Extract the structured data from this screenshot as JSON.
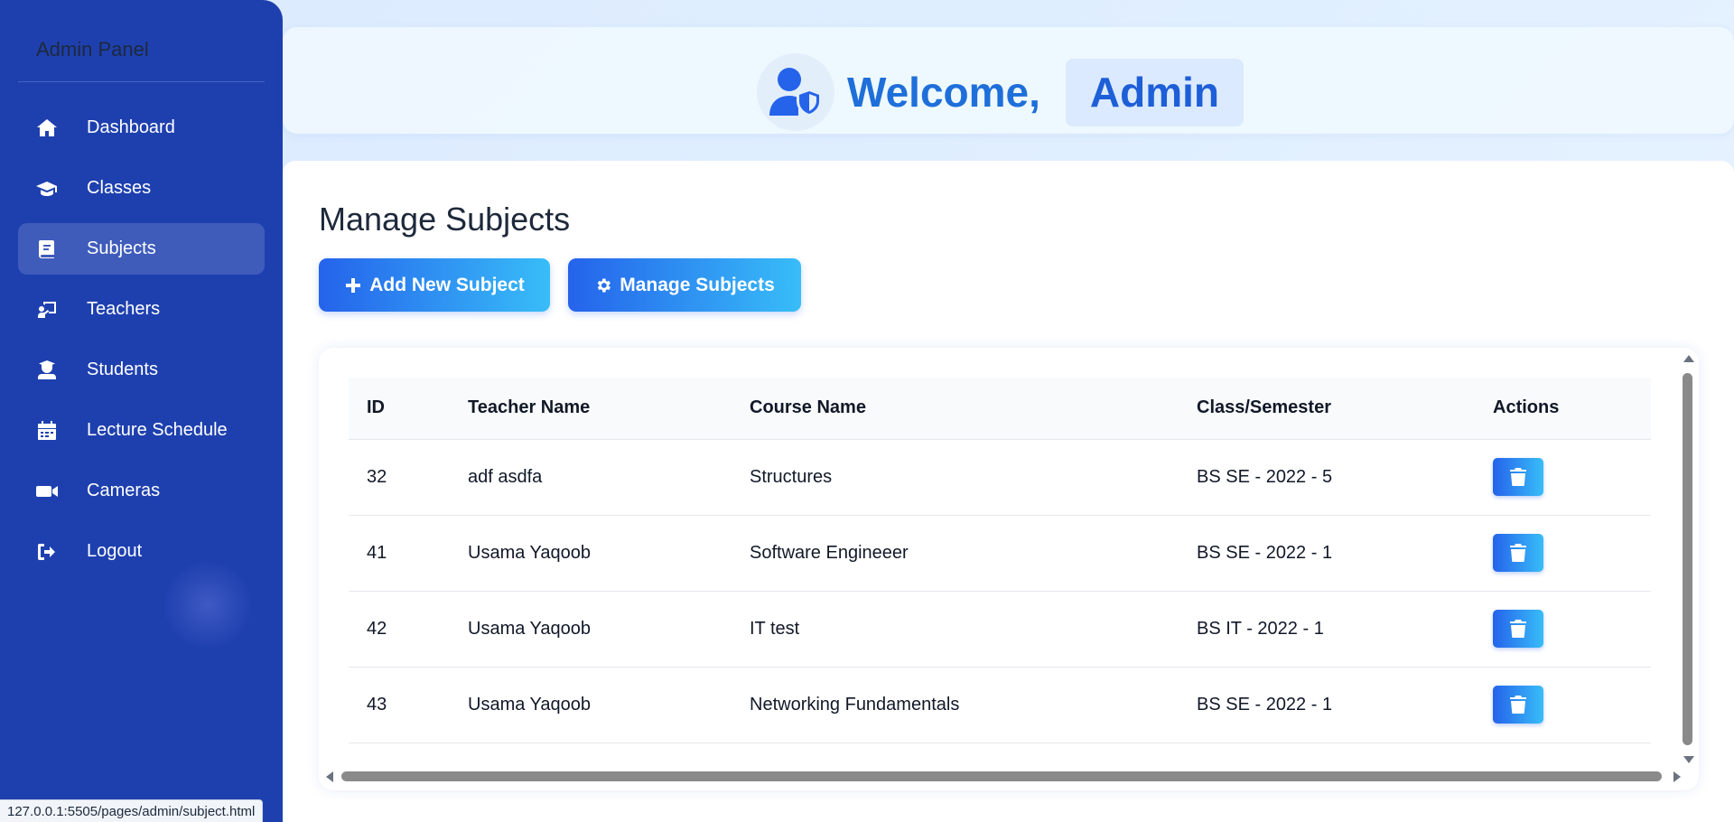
{
  "sidebar": {
    "brand": "Admin Panel",
    "items": [
      {
        "label": "Dashboard",
        "icon": "home-icon",
        "active": false
      },
      {
        "label": "Classes",
        "icon": "graduation-cap-icon",
        "active": false
      },
      {
        "label": "Subjects",
        "icon": "book-icon",
        "active": true
      },
      {
        "label": "Teachers",
        "icon": "chalkboard-teacher-icon",
        "active": false
      },
      {
        "label": "Students",
        "icon": "user-graduate-icon",
        "active": false
      },
      {
        "label": "Lecture Schedule",
        "icon": "calendar-icon",
        "active": false
      },
      {
        "label": "Cameras",
        "icon": "video-camera-icon",
        "active": false
      },
      {
        "label": "Logout",
        "icon": "sign-out-icon",
        "active": false
      }
    ]
  },
  "header": {
    "greeting": "Welcome,",
    "user_name": "Admin",
    "avatar_icon": "user-shield-icon"
  },
  "main": {
    "title": "Manage Subjects",
    "add_button": "Add New Subject",
    "manage_button": "Manage Subjects"
  },
  "table": {
    "columns": [
      "ID",
      "Teacher Name",
      "Course Name",
      "Class/Semester",
      "Actions"
    ],
    "rows": [
      {
        "id": "32",
        "teacher": "adf asdfa",
        "course": "Structures",
        "class": "BS SE - 2022 - 5"
      },
      {
        "id": "41",
        "teacher": "Usama Yaqoob",
        "course": "Software Engineeer",
        "class": "BS SE - 2022 - 1"
      },
      {
        "id": "42",
        "teacher": "Usama Yaqoob",
        "course": "IT test",
        "class": "BS IT - 2022 - 1"
      },
      {
        "id": "43",
        "teacher": "Usama Yaqoob",
        "course": "Networking Fundamentals",
        "class": "BS SE - 2022 - 1"
      }
    ]
  },
  "statusbar": {
    "url": "127.0.0.1:5505/pages/admin/subject.html"
  },
  "colors": {
    "sidebar": "#1e40af",
    "accent": "#2563eb",
    "accent_light": "#38bdf8",
    "title_blue": "#1e6fd9"
  }
}
